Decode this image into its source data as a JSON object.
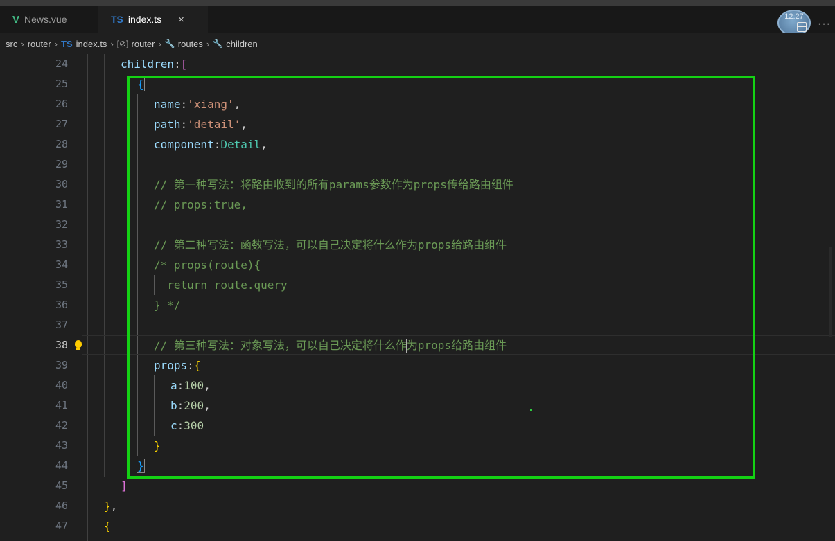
{
  "tabs": [
    {
      "icon": "V",
      "label": "News.vue",
      "active": false
    },
    {
      "icon": "TS",
      "label": "index.ts",
      "active": true,
      "close": "×"
    }
  ],
  "avatar_time": "12:27",
  "more": "···",
  "breadcrumb": {
    "parts": [
      "src",
      "router"
    ],
    "file_icon": "TS",
    "file": "index.ts",
    "sym1_icon": "[⊘]",
    "sym1": "router",
    "sym2_icon": "🔧",
    "sym2": "routes",
    "sym3_icon": "🔧",
    "sym3": "children"
  },
  "lines": {
    "n24": "24",
    "n25": "25",
    "n26": "26",
    "n27": "27",
    "n28": "28",
    "n29": "29",
    "n30": "30",
    "n31": "31",
    "n32": "32",
    "n33": "33",
    "n34": "34",
    "n35": "35",
    "n36": "36",
    "n37": "37",
    "n38": "38",
    "n39": "39",
    "n40": "40",
    "n41": "41",
    "n42": "42",
    "n43": "43",
    "n44": "44",
    "n45": "45",
    "n46": "46",
    "n47": "47"
  },
  "code": {
    "l24_key": "children",
    "l24_colon": ":",
    "l24_br": "[",
    "l25_br": "{",
    "l26_key": "name",
    "l26_colon": ":",
    "l26_val": "'xiang'",
    "l26_end": ",",
    "l27_key": "path",
    "l27_colon": ":",
    "l27_val": "'detail'",
    "l27_end": ",",
    "l28_key": "component",
    "l28_colon": ":",
    "l28_val": "Detail",
    "l28_end": ",",
    "l30": "// 第一种写法：将路由收到的所有params参数作为props传给路由组件",
    "l31": "// props:true,",
    "l33": "// 第二种写法：函数写法，可以自己决定将什么作为props给路由组件",
    "l34": "/* props(route){",
    "l35": "  return route.query",
    "l36": "} */",
    "l38_a": "// 第三种写法：对象写法，可以自己决定将什么作",
    "l38_b": "为props给路由组件",
    "l39_key": "props",
    "l39_colon": ":",
    "l39_br": "{",
    "l40_key": "a",
    "l40_colon": ":",
    "l40_val": "100",
    "l40_end": ",",
    "l41_key": "b",
    "l41_colon": ":",
    "l41_val": "200",
    "l41_end": ",",
    "l42_key": "c",
    "l42_colon": ":",
    "l42_val": "300",
    "l43_br": "}",
    "l44_br": "}",
    "l45_br": "]",
    "l46_br": "}",
    "l46_end": ",",
    "l47_br": "{"
  },
  "colors": {
    "highlight_box": "#14d114",
    "accent_vue": "#41b883",
    "accent_ts": "#3178c6"
  }
}
